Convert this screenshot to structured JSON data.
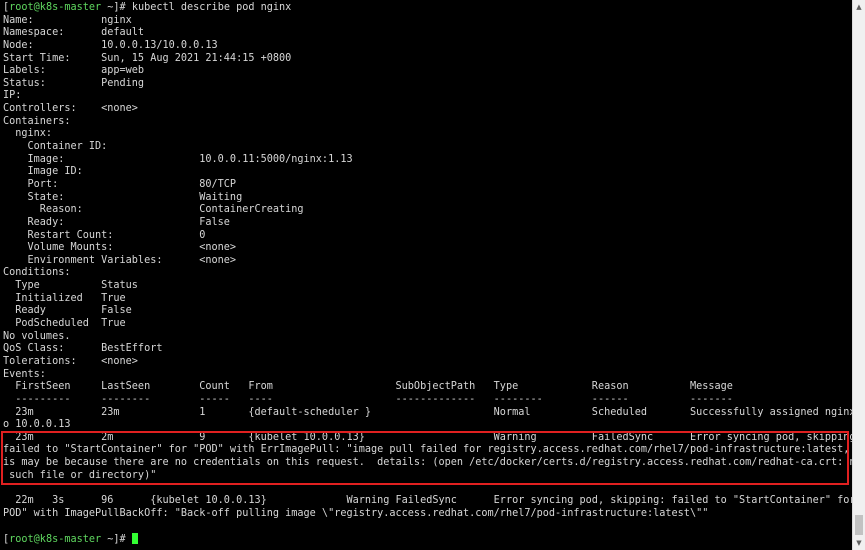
{
  "prompt": {
    "open_bracket": "[",
    "user_host": "root@k8s-master",
    "path_close": " ~]# ",
    "command": "kubectl describe pod nginx"
  },
  "lines": [
    "Name:           nginx",
    "Namespace:      default",
    "Node:           10.0.0.13/10.0.0.13",
    "Start Time:     Sun, 15 Aug 2021 21:44:15 +0800",
    "Labels:         app=web",
    "Status:         Pending",
    "IP:",
    "Controllers:    <none>",
    "Containers:",
    "  nginx:",
    "    Container ID:",
    "    Image:                      10.0.0.11:5000/nginx:1.13",
    "    Image ID:",
    "    Port:                       80/TCP",
    "    State:                      Waiting",
    "      Reason:                   ContainerCreating",
    "    Ready:                      False",
    "    Restart Count:              0",
    "    Volume Mounts:              <none>",
    "    Environment Variables:      <none>",
    "Conditions:",
    "  Type          Status",
    "  Initialized   True",
    "  Ready         False",
    "  PodScheduled  True",
    "No volumes.",
    "QoS Class:      BestEffort",
    "Tolerations:    <none>",
    "Events:",
    "  FirstSeen     LastSeen        Count   From                    SubObjectPath   Type            Reason          Message",
    "  ---------     --------        -----   ----                    -------------   --------        ------          -------",
    "  23m           23m             1       {default-scheduler }                    Normal          Scheduled       Successfully assigned nginx t",
    "o 10.0.0.13",
    "  23m           2m              9       {kubelet 10.0.0.13}                     Warning         FailedSync      Error syncing pod, skipping:",
    "failed to \"StartContainer\" for \"POD\" with ErrImagePull: \"image pull failed for registry.access.redhat.com/rhel7/pod-infrastructure:latest, th",
    "is may be because there are no credentials on this request.  details: (open /etc/docker/certs.d/registry.access.redhat.com/redhat-ca.crt: no",
    " such file or directory)\"",
    "",
    "  22m   3s      96      {kubelet 10.0.0.13}             Warning FailedSync      Error syncing pod, skipping: failed to \"StartContainer\" for \"",
    "POD\" with ImagePullBackOff: \"Back-off pulling image \\\"registry.access.redhat.com/rhel7/pod-infrastructure:latest\\\"\"",
    ""
  ],
  "final_prompt": {
    "open_bracket": "[",
    "user_host": "root@k8s-master",
    "path_close": " ~]# "
  },
  "scrollbar": {
    "up_glyph": "▲",
    "down_glyph": "▼"
  },
  "colors": {
    "background": "#000000",
    "foreground": "#d7d7d7",
    "prompt_user": "#5fd75f",
    "highlight_border": "#e02020",
    "cursor": "#33ff33"
  }
}
